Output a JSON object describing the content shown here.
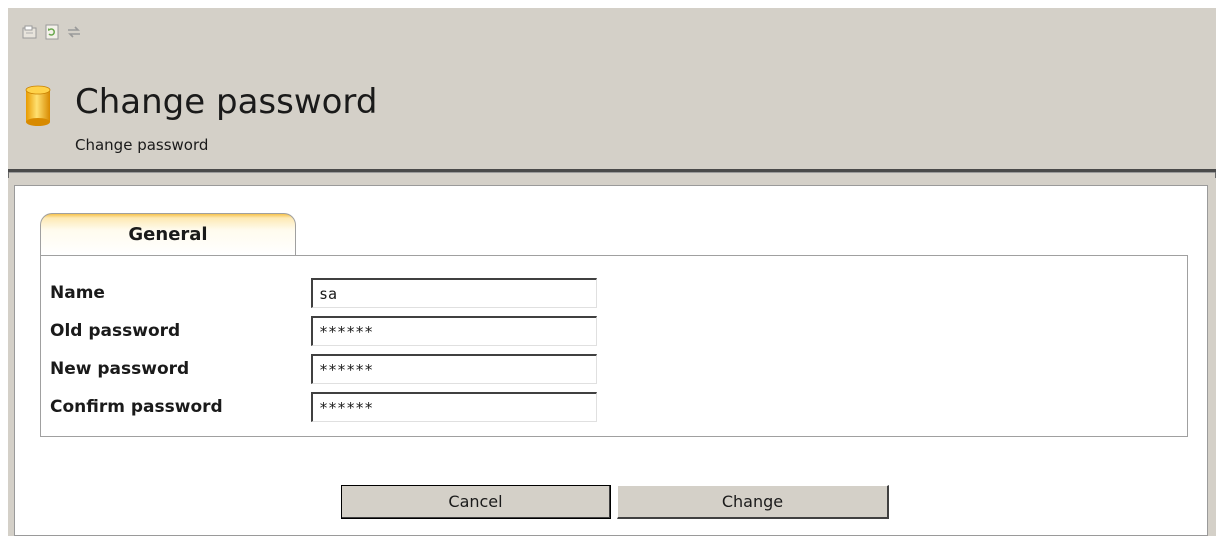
{
  "toolbar": {
    "icons": [
      "open-icon",
      "refresh-icon",
      "sync-icon"
    ]
  },
  "header": {
    "icon": "database-icon",
    "title": "Change password",
    "subtitle": "Change password"
  },
  "tabs": [
    {
      "label": "General",
      "active": true
    }
  ],
  "form": {
    "fields": [
      {
        "label": "Name",
        "value": "sa"
      },
      {
        "label": "Old password",
        "value": "******"
      },
      {
        "label": "New password",
        "value": "******"
      },
      {
        "label": "Confirm password",
        "value": "******"
      }
    ]
  },
  "buttons": {
    "cancel_label": "Cancel",
    "change_label": "Change"
  },
  "colors": {
    "chrome": "#d4d0c8",
    "tab_accent": "#f6c24c",
    "db_icon": "#f5b800"
  }
}
